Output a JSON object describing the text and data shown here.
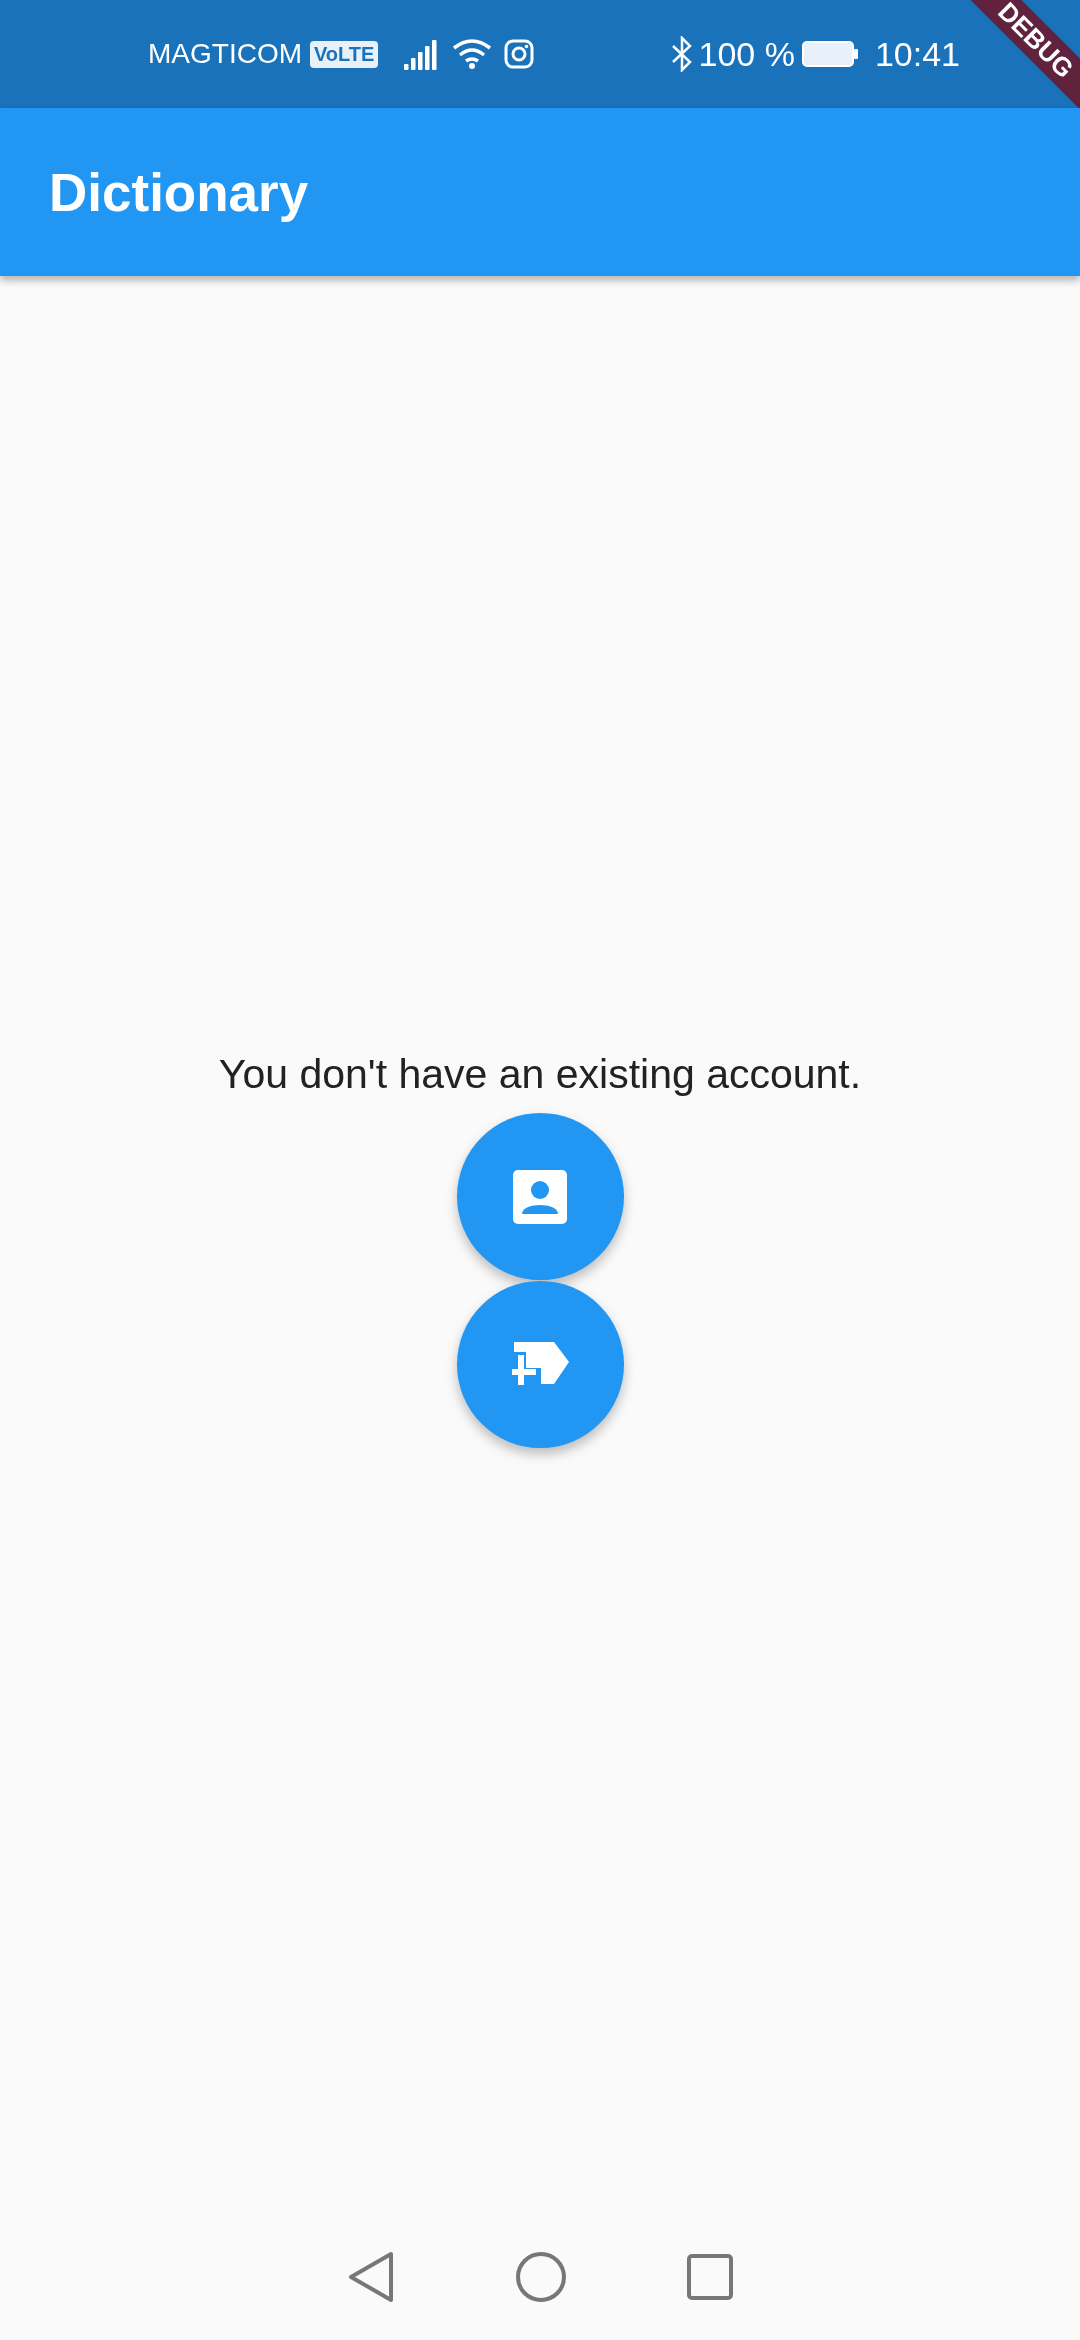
{
  "status_bar": {
    "carrier": "MAGTICOM",
    "network_badge": "VoLTE",
    "battery": "100 %",
    "time": "10:41"
  },
  "debug_banner": "DEBUG",
  "app_bar": {
    "title": "Dictionary"
  },
  "message": "You don't have an existing account.",
  "actions": [
    {
      "kind": "account"
    },
    {
      "kind": "new-label"
    }
  ],
  "nav_bar": [
    {
      "kind": "back"
    },
    {
      "kind": "home"
    },
    {
      "kind": "recents"
    }
  ]
}
